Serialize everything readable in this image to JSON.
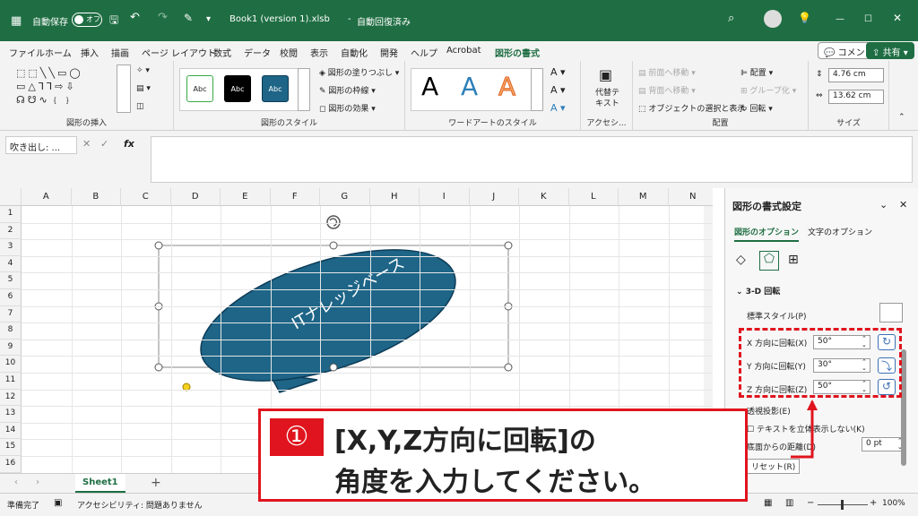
{
  "titlebar": {
    "autosave_label": "自動保存",
    "autosave_state": "オフ",
    "filename": "Book1 (version 1).xlsb",
    "save_status": "自動回復済み"
  },
  "tabs": [
    "ファイル",
    "ホーム",
    "挿入",
    "描画",
    "ページ レイアウト",
    "数式",
    "データ",
    "校閲",
    "表示",
    "自動化",
    "開発",
    "ヘルプ",
    "Acrobat",
    "図形の書式"
  ],
  "header_buttons": {
    "comment": "コメント",
    "share": "共有"
  },
  "ribbon": {
    "insert_shape_label": "図形の挿入",
    "shape_style_label": "図形のスタイル",
    "style_samples": [
      "Abc",
      "Abc",
      "Abc"
    ],
    "fill": "図形の塗りつぶし",
    "outline": "図形の枠線",
    "effect": "図形の効果",
    "wordart_label": "ワードアートのスタイル",
    "wordart_sample": "A",
    "alt_text": [
      "代替テ",
      "キスト"
    ],
    "accessibility_label": "アクセシ...",
    "bring_forward": "前面へ移動",
    "send_backward": "背面へ移動",
    "selection_pane": "オブジェクトの選択と表示",
    "align": "配置",
    "group": "グループ化",
    "rotate": "回転",
    "arrange_label": "配置",
    "height": "4.76 cm",
    "width": "13.62 cm",
    "size_label": "サイズ"
  },
  "formula": {
    "namebox": "吹き出し: ...",
    "fx": "fx"
  },
  "columns": [
    "A",
    "B",
    "C",
    "D",
    "E",
    "F",
    "G",
    "H",
    "I",
    "J",
    "K",
    "L",
    "M",
    "N"
  ],
  "rows": [
    "1",
    "2",
    "3",
    "4",
    "5",
    "6",
    "7",
    "8",
    "9",
    "10",
    "11",
    "12",
    "13",
    "14",
    "15",
    "16"
  ],
  "shape_text": "ITナレッジベース",
  "sheet_tab": "Sheet1",
  "status": {
    "ready": "準備完了",
    "accessibility": "アクセシビリティ: 問題ありません",
    "zoom": "100%"
  },
  "pane": {
    "title": "図形の書式設定",
    "tab_shape": "図形のオプション",
    "tab_text": "文字のオプション",
    "section": "3-D 回転",
    "preset": "標準スタイル(P)",
    "x_label": "X 方向に回転(X)",
    "x_value": "50°",
    "y_label": "Y 方向に回転(Y)",
    "y_value": "30°",
    "z_label": "Z 方向に回転(Z)",
    "z_value": "50°",
    "perspective": "透視投影(E)",
    "keep_flat": "テキストを立体表示しない(K)",
    "distance": "底面からの距離(D)",
    "distance_value": "0 pt",
    "reset": "リセット(R)"
  },
  "callout": {
    "number": "①",
    "line1": "[X,Y,Z方向に回転]の",
    "line2": "角度を入力してください。"
  },
  "colors": {
    "excel_green": "#1f6e43",
    "shape_fill": "#1e6587",
    "red": "#e0141e"
  }
}
